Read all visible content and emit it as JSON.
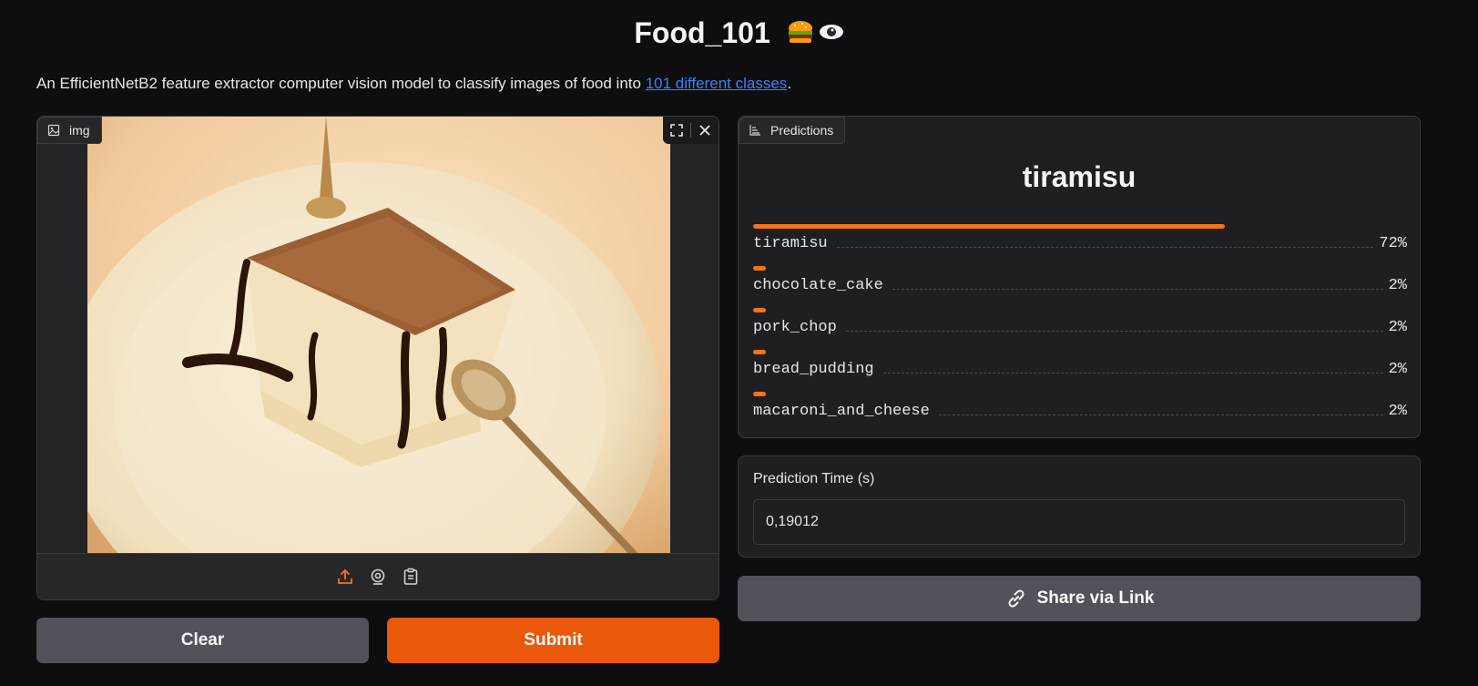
{
  "header": {
    "title": "Food_101",
    "emoji": "🍔👁",
    "description_prefix": "An EfficientNetB2 feature extractor computer vision model to classify images of food into ",
    "description_link": "101 different classes",
    "description_suffix": "."
  },
  "image_input": {
    "label": "img",
    "upload_icon": "upload-icon",
    "webcam_icon": "webcam-icon",
    "clipboard_icon": "clipboard-icon",
    "fullscreen_icon": "fullscreen-icon",
    "close_icon": "close-icon"
  },
  "predictions": {
    "label": "Predictions",
    "top_label": "tiramisu",
    "items": [
      {
        "label": "tiramisu",
        "percent": "72%",
        "confidence": 0.72
      },
      {
        "label": "chocolate_cake",
        "percent": "2%",
        "confidence": 0.02
      },
      {
        "label": "pork_chop",
        "percent": "2%",
        "confidence": 0.02
      },
      {
        "label": "bread_pudding",
        "percent": "2%",
        "confidence": 0.02
      },
      {
        "label": "macaroni_and_cheese",
        "percent": "2%",
        "confidence": 0.02
      }
    ]
  },
  "prediction_time": {
    "label": "Prediction Time (s)",
    "value": "0,19012"
  },
  "buttons": {
    "share": "Share via Link",
    "clear": "Clear",
    "submit": "Submit"
  },
  "colors": {
    "accent": "#ea580c",
    "bar": "#f97316",
    "link": "#3b82f6"
  }
}
